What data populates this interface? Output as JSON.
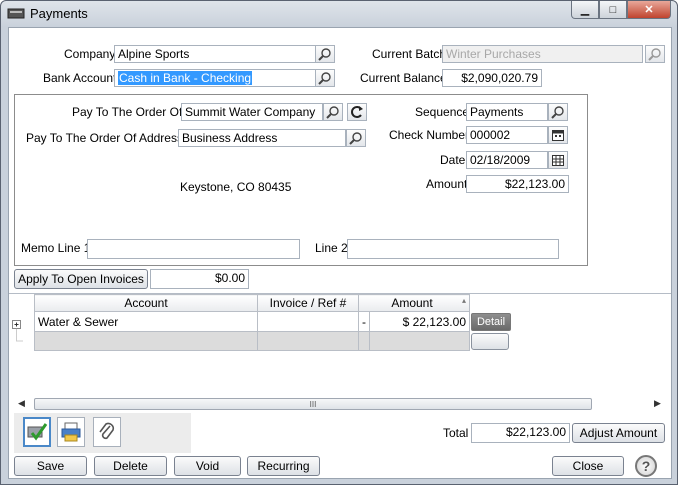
{
  "window": {
    "title": "Payments"
  },
  "header": {
    "company_label": "Company",
    "company_value": "Alpine Sports",
    "bank_account_label": "Bank Account",
    "bank_account_value": "Cash in Bank - Checking",
    "current_batch_label": "Current Batch",
    "current_batch_value": "Winter Purchases",
    "current_balance_label": "Current Balance",
    "current_balance_value": "$2,090,020.79"
  },
  "payee": {
    "pay_to_label": "Pay To The Order Of",
    "pay_to_value": "Summit Water Company",
    "address_label": "Pay To The Order Of Address",
    "address_value": "Business Address",
    "address_city": "Keystone, CO  80435",
    "sequence_label": "Sequence",
    "sequence_value": "Payments",
    "check_number_label": "Check Number",
    "check_number_value": "000002",
    "date_label": "Date",
    "date_value": "02/18/2009",
    "amount_label": "Amount",
    "amount_value": "$22,123.00",
    "memo1_label": "Memo Line 1",
    "memo1_value": "",
    "memo2_label": "Line 2",
    "memo2_value": ""
  },
  "apply": {
    "button_label": "Apply To Open Invoices",
    "value": "$0.00"
  },
  "grid": {
    "columns": [
      "Account",
      "Invoice / Ref #",
      "Amount"
    ],
    "rows": [
      {
        "account": "Water & Sewer",
        "ref": "",
        "flag": "-",
        "amount": "$ 22,123.00",
        "action": "Detail"
      }
    ],
    "scroll_thumb": "III"
  },
  "totals": {
    "total_label": "Total",
    "total_value": "$22,123.00",
    "adjust_label": "Adjust Amount"
  },
  "footer": {
    "save": "Save",
    "delete": "Delete",
    "void": "Void",
    "recurring": "Recurring",
    "close": "Close",
    "help": "?"
  },
  "icons": {
    "title": "checkbook-icon",
    "lookup": "magnifier-icon",
    "refresh": "refresh-arrow-icon",
    "calendar": "calendar-icon",
    "approve": "check-approve-icon",
    "print": "printer-icon",
    "attach": "paperclip-icon",
    "help": "help-icon"
  },
  "colors": {
    "selection": "#3399ff",
    "close_button": "#c0432e",
    "active_tool": "#4a88c8"
  }
}
